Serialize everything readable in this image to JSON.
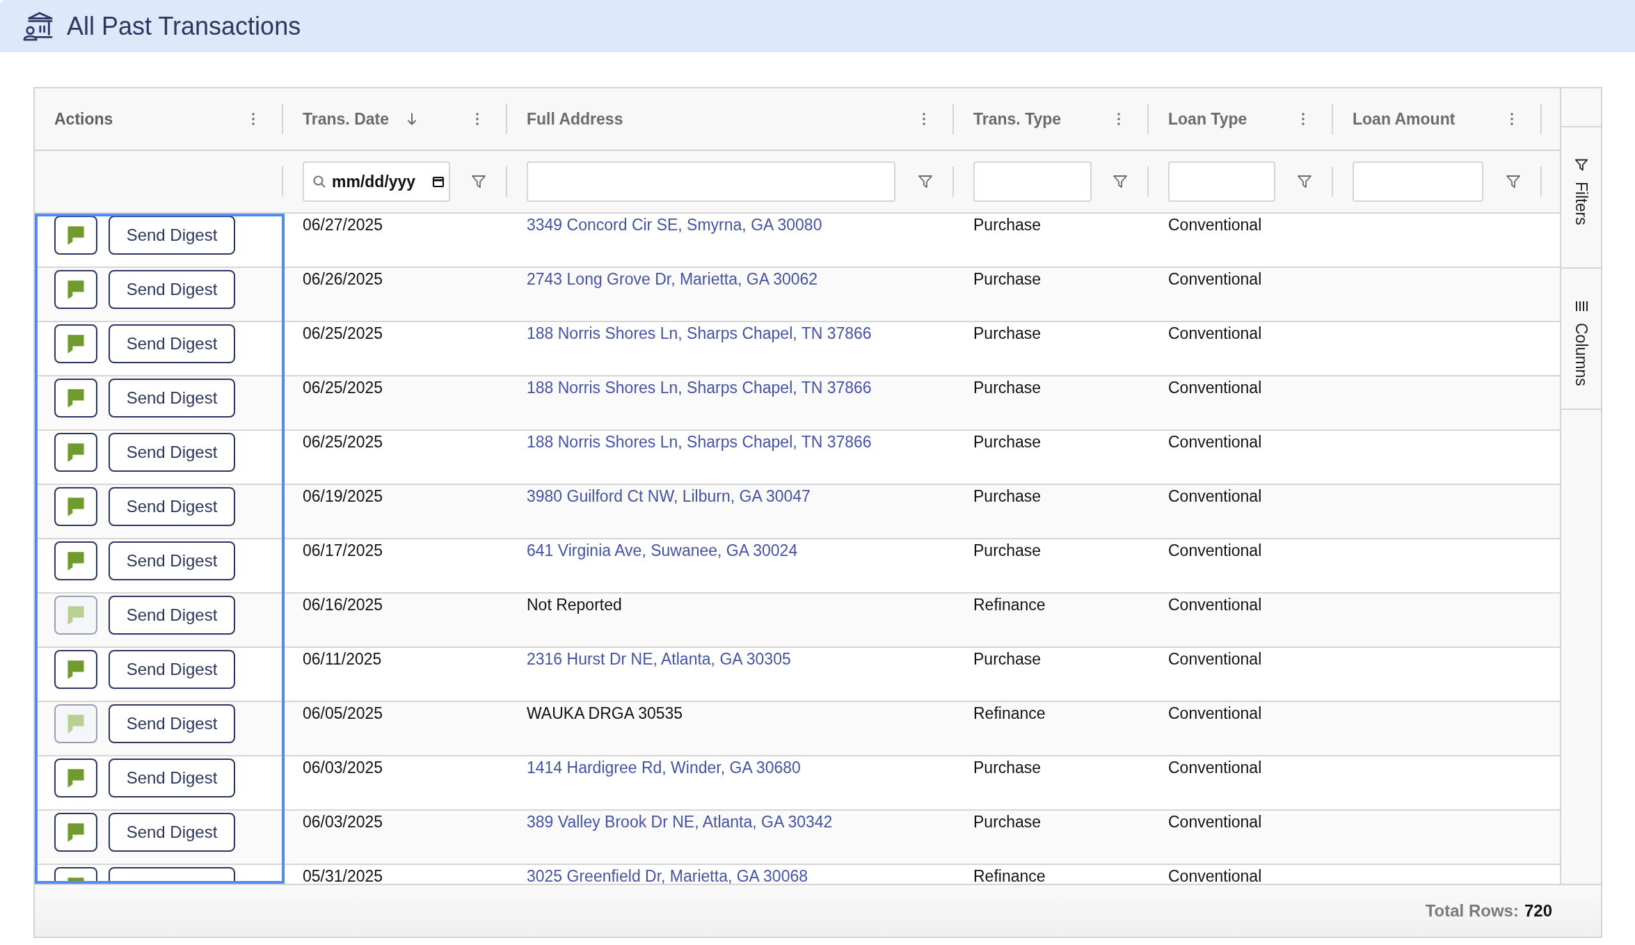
{
  "page": {
    "title": "All Past Transactions"
  },
  "table": {
    "columns": [
      {
        "label": "Actions",
        "selected": true,
        "sorted": false
      },
      {
        "label": "Trans. Date",
        "selected": false,
        "sorted": true,
        "filter": {
          "kind": "date",
          "value": "mm/dd/yyy"
        }
      },
      {
        "label": "Full Address",
        "selected": false,
        "sorted": false,
        "filter": {
          "kind": "text"
        }
      },
      {
        "label": "Trans. Type",
        "selected": false,
        "sorted": false,
        "filter": {
          "kind": "text"
        }
      },
      {
        "label": "Loan Type",
        "selected": false,
        "sorted": false,
        "filter": {
          "kind": "text"
        }
      },
      {
        "label": "Loan Amount",
        "selected": false,
        "sorted": false,
        "filter": {
          "kind": "text"
        }
      }
    ],
    "rows": [
      {
        "enabled": true,
        "button": "Send Digest",
        "date": "06/27/2025",
        "address": "3349 Concord Cir SE, Smyrna, GA 30080",
        "linked": true,
        "trans_type": "Purchase",
        "loan_type": "Conventional"
      },
      {
        "enabled": true,
        "button": "Send Digest",
        "date": "06/26/2025",
        "address": "2743 Long Grove Dr, Marietta, GA 30062",
        "linked": true,
        "trans_type": "Purchase",
        "loan_type": "Conventional"
      },
      {
        "enabled": true,
        "button": "Send Digest",
        "date": "06/25/2025",
        "address": "188 Norris Shores Ln, Sharps Chapel, TN 37866",
        "linked": true,
        "trans_type": "Purchase",
        "loan_type": "Conventional"
      },
      {
        "enabled": true,
        "button": "Send Digest",
        "date": "06/25/2025",
        "address": "188 Norris Shores Ln, Sharps Chapel, TN 37866",
        "linked": true,
        "trans_type": "Purchase",
        "loan_type": "Conventional"
      },
      {
        "enabled": true,
        "button": "Send Digest",
        "date": "06/25/2025",
        "address": "188 Norris Shores Ln, Sharps Chapel, TN 37866",
        "linked": true,
        "trans_type": "Purchase",
        "loan_type": "Conventional"
      },
      {
        "enabled": true,
        "button": "Send Digest",
        "date": "06/19/2025",
        "address": "3980 Guilford Ct NW, Lilburn, GA 30047",
        "linked": true,
        "trans_type": "Purchase",
        "loan_type": "Conventional"
      },
      {
        "enabled": true,
        "button": "Send Digest",
        "date": "06/17/2025",
        "address": "641 Virginia Ave, Suwanee, GA 30024",
        "linked": true,
        "trans_type": "Purchase",
        "loan_type": "Conventional"
      },
      {
        "enabled": false,
        "button": "Send Digest",
        "date": "06/16/2025",
        "address": "Not Reported",
        "linked": false,
        "trans_type": "Refinance",
        "loan_type": "Conventional"
      },
      {
        "enabled": true,
        "button": "Send Digest",
        "date": "06/11/2025",
        "address": "2316 Hurst Dr NE, Atlanta, GA 30305",
        "linked": true,
        "trans_type": "Purchase",
        "loan_type": "Conventional"
      },
      {
        "enabled": false,
        "button": "Send Digest",
        "date": "06/05/2025",
        "address": "WAUKA DRGA 30535",
        "linked": false,
        "trans_type": "Refinance",
        "loan_type": "Conventional"
      },
      {
        "enabled": true,
        "button": "Send Digest",
        "date": "06/03/2025",
        "address": "1414 Hardigree Rd, Winder, GA 30680",
        "linked": true,
        "trans_type": "Purchase",
        "loan_type": "Conventional"
      },
      {
        "enabled": true,
        "button": "Send Digest",
        "date": "06/03/2025",
        "address": "389 Valley Brook Dr NE, Atlanta, GA 30342",
        "linked": true,
        "trans_type": "Purchase",
        "loan_type": "Conventional"
      },
      {
        "enabled": true,
        "date": "05/31/2025",
        "address": "3025 Greenfield Dr, Marietta, GA 30068",
        "linked": true,
        "trans_type": "Refinance",
        "loan_type": "Conventional"
      }
    ]
  },
  "side_panel": {
    "tabs": [
      "Filters",
      "Columns"
    ]
  },
  "status_bar": {
    "label": "Total Rows:",
    "value": "720"
  }
}
